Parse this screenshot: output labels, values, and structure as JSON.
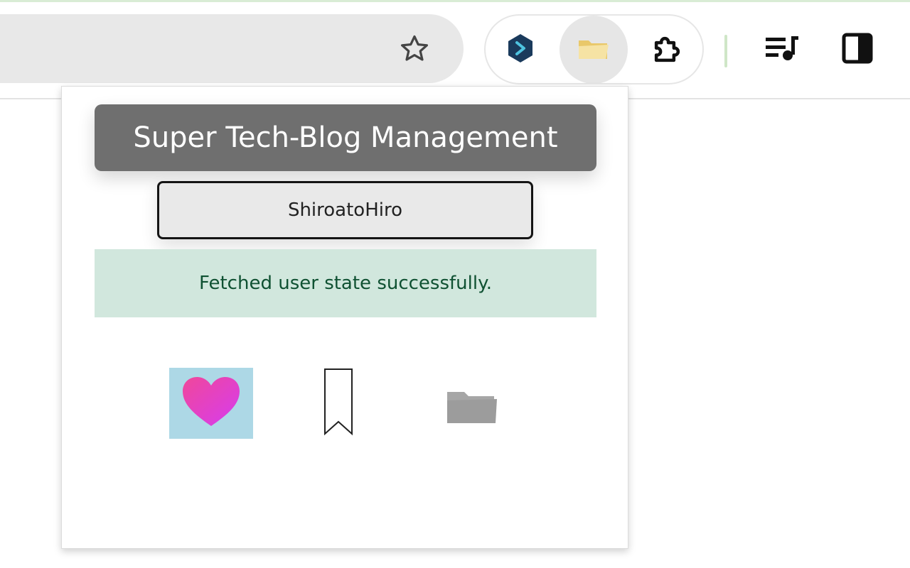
{
  "popup": {
    "title": "Super Tech-Blog Management",
    "username": "ShiroatoHiro",
    "status_message": "Fetched user state successfully."
  },
  "icons": {
    "toolbar": [
      "star-icon",
      "hexagon-extension-icon",
      "folder-extension-icon",
      "puzzle-extensions-icon",
      "media-queue-icon",
      "side-panel-icon"
    ],
    "actions": [
      "heart-icon",
      "bookmark-icon",
      "folder-icon"
    ]
  },
  "colors": {
    "title_bg": "#6f6f6f",
    "status_bg": "#d1e7dd",
    "status_text": "#0f5132",
    "heart_tile_bg": "#add8e6",
    "heart": "#e83eb0",
    "folder_gray": "#a6a6a6"
  }
}
